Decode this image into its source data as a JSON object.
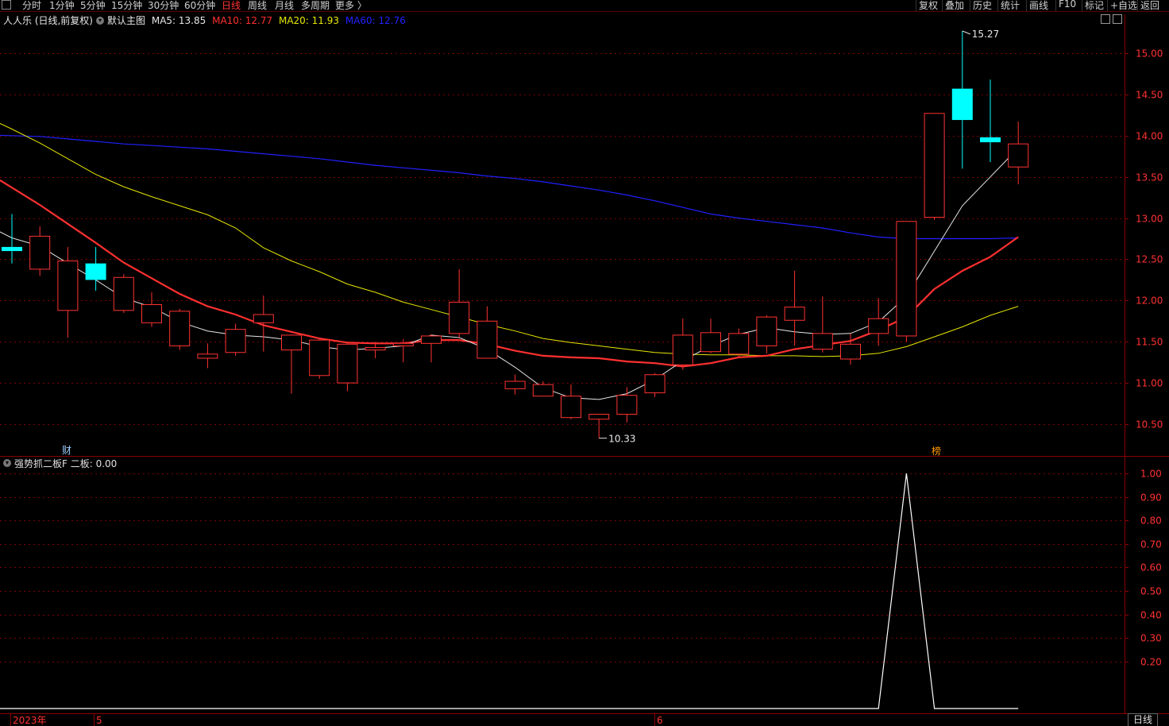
{
  "toolbar": {
    "left": [
      "分时",
      "1分钟",
      "5分钟",
      "15分钟",
      "30分钟",
      "60分钟",
      "日线",
      "周线",
      "月线",
      "多周期",
      "更多 〉"
    ],
    "active": "日线",
    "right": [
      "复权",
      "叠加",
      "历史",
      "统计",
      "画线",
      "F10",
      "标记",
      "+自选",
      "返回"
    ]
  },
  "legend": {
    "stock": "人人乐 (日线,前复权)",
    "main": "默认主图",
    "ma5": {
      "label": "MA5: 13.85",
      "color": "#e6e6e6"
    },
    "ma10": {
      "label": "MA10: 12.77",
      "color": "#ff3030"
    },
    "ma20": {
      "label": "MA20: 11.93",
      "color": "#e6e600"
    },
    "ma60": {
      "label": "MA60: 12.76",
      "color": "#2020ff"
    }
  },
  "indicator_legend": "强势抓二板F  二板: 0.00",
  "markers": {
    "cai": "财",
    "bang": "榜"
  },
  "bottom_tab": "日线",
  "chart_data": [
    {
      "type": "candlestick",
      "y_ticks": [
        "15.00",
        "14.50",
        "14.00",
        "13.50",
        "13.00",
        "12.50",
        "12.00",
        "11.50",
        "11.00",
        "10.50"
      ],
      "ylim": [
        10.15,
        15.55
      ],
      "x_labels": [
        {
          "index": 0,
          "text": "2023年"
        },
        {
          "index": 3,
          "text": "5"
        },
        {
          "index": 23,
          "text": "6"
        }
      ],
      "high_annotation": {
        "index": 34,
        "text": "15.27"
      },
      "low_annotation": {
        "index": 21,
        "text": "10.33"
      },
      "candles": [
        {
          "o": 12.65,
          "c": 12.6,
          "h": 13.05,
          "l": 12.45
        },
        {
          "o": 12.38,
          "c": 12.78,
          "h": 12.9,
          "l": 12.3
        },
        {
          "o": 11.88,
          "c": 12.48,
          "h": 12.65,
          "l": 11.55
        },
        {
          "o": 12.45,
          "c": 12.25,
          "h": 12.65,
          "l": 12.12
        },
        {
          "o": 11.88,
          "c": 12.28,
          "h": 12.32,
          "l": 11.85
        },
        {
          "o": 11.73,
          "c": 11.95,
          "h": 12.1,
          "l": 11.68
        },
        {
          "o": 11.45,
          "c": 11.87,
          "h": 11.9,
          "l": 11.4
        },
        {
          "o": 11.3,
          "c": 11.35,
          "h": 11.48,
          "l": 11.18
        },
        {
          "o": 11.37,
          "c": 11.65,
          "h": 11.72,
          "l": 11.33
        },
        {
          "o": 11.73,
          "c": 11.83,
          "h": 12.06,
          "l": 11.38
        },
        {
          "o": 11.4,
          "c": 11.58,
          "h": 11.59,
          "l": 10.87
        },
        {
          "o": 11.09,
          "c": 11.52,
          "h": 11.53,
          "l": 11.05
        },
        {
          "o": 11.0,
          "c": 11.47,
          "h": 11.49,
          "l": 10.9
        },
        {
          "o": 11.4,
          "c": 11.43,
          "h": 11.5,
          "l": 11.3
        },
        {
          "o": 11.45,
          "c": 11.48,
          "h": 11.53,
          "l": 11.25
        },
        {
          "o": 11.48,
          "c": 11.57,
          "h": 11.59,
          "l": 11.25
        },
        {
          "o": 11.6,
          "c": 11.98,
          "h": 12.38,
          "l": 11.55
        },
        {
          "o": 11.3,
          "c": 11.75,
          "h": 11.93,
          "l": 11.3
        },
        {
          "o": 10.93,
          "c": 11.02,
          "h": 11.1,
          "l": 10.86
        },
        {
          "o": 10.84,
          "c": 10.98,
          "h": 11.02,
          "l": 10.84
        },
        {
          "o": 10.58,
          "c": 10.84,
          "h": 10.98,
          "l": 10.56
        },
        {
          "o": 10.56,
          "c": 10.62,
          "h": 10.62,
          "l": 10.33
        },
        {
          "o": 10.62,
          "c": 10.85,
          "h": 10.95,
          "l": 10.52
        },
        {
          "o": 10.88,
          "c": 11.1,
          "h": 11.12,
          "l": 10.83
        },
        {
          "o": 11.22,
          "c": 11.58,
          "h": 11.78,
          "l": 11.16
        },
        {
          "o": 11.38,
          "c": 11.61,
          "h": 11.78,
          "l": 11.36
        },
        {
          "o": 11.35,
          "c": 11.6,
          "h": 11.66,
          "l": 11.3
        },
        {
          "o": 11.45,
          "c": 11.8,
          "h": 11.82,
          "l": 11.36
        },
        {
          "o": 11.76,
          "c": 11.92,
          "h": 12.36,
          "l": 11.45
        },
        {
          "o": 11.41,
          "c": 11.6,
          "h": 12.05,
          "l": 11.37
        },
        {
          "o": 11.29,
          "c": 11.47,
          "h": 11.6,
          "l": 11.22
        },
        {
          "o": 11.6,
          "c": 11.78,
          "h": 12.03,
          "l": 11.45
        },
        {
          "o": 11.57,
          "c": 12.96,
          "h": 12.96,
          "l": 11.5
        },
        {
          "o": 13.01,
          "c": 14.27,
          "h": 14.27,
          "l": 12.98
        },
        {
          "o": 14.57,
          "c": 14.19,
          "h": 15.27,
          "l": 13.6
        },
        {
          "o": 13.98,
          "c": 13.92,
          "h": 14.68,
          "l": 13.68
        },
        {
          "o": 13.62,
          "c": 13.9,
          "h": 14.17,
          "l": 13.41
        }
      ],
      "ma5": [
        13.22,
        12.93,
        12.76,
        12.66,
        12.45,
        12.25,
        12.03,
        11.92,
        11.74,
        11.63,
        11.58,
        11.56,
        11.52,
        11.44,
        11.4,
        11.42,
        11.45,
        11.58,
        11.55,
        11.41,
        11.19,
        10.94,
        10.82,
        10.8,
        10.87,
        11.04,
        11.27,
        11.45,
        11.59,
        11.67,
        11.62,
        11.59,
        11.6,
        11.74,
        12.05,
        12.6,
        13.15,
        13.5,
        13.85
      ],
      "ma10": [
        13.85,
        13.58,
        13.37,
        13.16,
        12.93,
        12.7,
        12.46,
        12.27,
        12.08,
        11.93,
        11.83,
        11.7,
        11.62,
        11.54,
        11.49,
        11.48,
        11.48,
        11.52,
        11.52,
        11.47,
        11.39,
        11.33,
        11.31,
        11.3,
        11.26,
        11.24,
        11.2,
        11.24,
        11.31,
        11.33,
        11.41,
        11.46,
        11.51,
        11.64,
        11.8,
        12.14,
        12.36,
        12.53,
        12.77
      ],
      "ma20": [
        14.32,
        14.24,
        14.08,
        13.91,
        13.72,
        13.53,
        13.38,
        13.26,
        13.15,
        13.04,
        12.88,
        12.64,
        12.48,
        12.35,
        12.2,
        12.1,
        11.98,
        11.89,
        11.8,
        11.71,
        11.63,
        11.54,
        11.49,
        11.45,
        11.41,
        11.37,
        11.35,
        11.34,
        11.34,
        11.33,
        11.33,
        11.32,
        11.33,
        11.36,
        11.44,
        11.56,
        11.68,
        11.82,
        11.93
      ],
      "ma60": [
        14.03,
        14.01,
        14.0,
        13.99,
        13.96,
        13.93,
        13.9,
        13.88,
        13.86,
        13.84,
        13.81,
        13.78,
        13.75,
        13.72,
        13.68,
        13.64,
        13.61,
        13.58,
        13.55,
        13.51,
        13.48,
        13.44,
        13.39,
        13.34,
        13.28,
        13.21,
        13.13,
        13.05,
        13.0,
        12.96,
        12.92,
        12.88,
        12.82,
        12.77,
        12.75,
        12.75,
        12.75,
        12.75,
        12.76
      ]
    },
    {
      "type": "line",
      "title": "强势抓二板F",
      "series": [
        {
          "name": "二板",
          "values": [
            0,
            0,
            0,
            0,
            0,
            0,
            0,
            0,
            0,
            0,
            0,
            0,
            0,
            0,
            0,
            0,
            0,
            0,
            0,
            0,
            0,
            0,
            0,
            0,
            0,
            0,
            0,
            0,
            0,
            0,
            0,
            0,
            0,
            0,
            1,
            0,
            0,
            0,
            0
          ]
        }
      ],
      "y_ticks": [
        "1.00",
        "0.90",
        "0.80",
        "0.70",
        "0.60",
        "0.50",
        "0.40",
        "0.30",
        "0.20"
      ],
      "ylim": [
        0,
        1.0
      ]
    }
  ]
}
